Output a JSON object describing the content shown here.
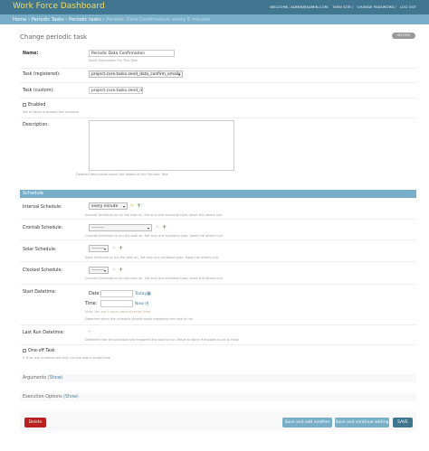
{
  "header": {
    "brand": "Work Force Dashboard",
    "welcome": "WELCOME, ADMIN@ADMIN.COM.",
    "view_site": "VIEW SITE",
    "change_password": "CHANGE PASSWORD",
    "logout": "LOG OUT"
  },
  "breadcrumbs": {
    "home": "Home",
    "sep": "›",
    "app": "Periodic Tasks",
    "model": "Periodic tasks",
    "current": "Periodic Data Confirmation: every 5 minutes"
  },
  "page": {
    "title": "Change periodic task",
    "history": "HISTORY"
  },
  "form": {
    "name_label": "Name:",
    "name_value": "Periodic Data Confirmation",
    "name_help": "Short Description For This Task",
    "task_registered_label": "Task (registered):",
    "task_registered_value": "project.core.tasks.send_data_confirm_emails",
    "task_custom_label": "Task (custom):",
    "task_custom_value": "project.core.tasks.send_dat",
    "enabled_label": "Enabled",
    "enabled_help": "Set to False to disable the schedule",
    "description_label": "Description:",
    "description_help": "Detailed description about the details of this Periodic Task"
  },
  "schedule": {
    "section_title": "Schedule",
    "interval_label": "Interval Schedule:",
    "interval_value": "every minute",
    "interval_help": "Interval Schedule to run the task on. Set only one schedule type, leave the others null.",
    "crontab_label": "Crontab Schedule:",
    "crontab_value": "---------",
    "crontab_help": "Crontab Schedule to run the task on. Set only one schedule type, leave the others null.",
    "solar_label": "Solar Schedule:",
    "solar_value": "---------",
    "solar_help": "Solar Schedule to run the task on. Set only one schedule type, leave the others null.",
    "clocked_label": "Clocked Schedule:",
    "clocked_value": "---------",
    "clocked_help": "Clocked Schedule to run the task on. Set only one schedule type, leave the others null.",
    "start_label": "Start Datetime:",
    "date_label": "Date:",
    "date_link": "Today",
    "time_label": "Time:",
    "time_link": "Now",
    "tz_note": "Note: You are 5 hours behind server time.",
    "start_help": "Datetime when the schedule should begin triggering the task to run",
    "last_run_label": "Last Run Datetime:",
    "last_run_value": "-",
    "last_run_help": "Datetime that the schedule last triggered the task to run. Reset to None if enabled is set to False",
    "oneoff_label": "One-off Task",
    "oneoff_help": "If True, the schedule will only run the task a single time"
  },
  "collapsed": {
    "arguments": "Arguments",
    "execution": "Execution Options",
    "show": "(Show)"
  },
  "buttons": {
    "delete": "Delete",
    "save_add": "Save and add another",
    "save_continue": "Save and continue editing",
    "save": "SAVE"
  },
  "icons": {
    "pencil": "pencil-icon",
    "plus": "plus-icon",
    "calendar": "calendar-icon",
    "clock": "clock-icon"
  }
}
